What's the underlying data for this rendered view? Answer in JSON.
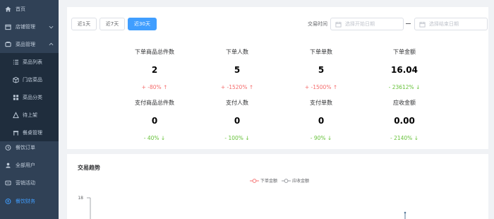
{
  "sidebar": {
    "items": [
      {
        "label": "首页",
        "icon": "home-icon"
      },
      {
        "label": "店铺管理",
        "icon": "shop-icon"
      },
      {
        "label": "菜品管理",
        "icon": "menu-icon"
      },
      {
        "label": "菜品列表",
        "icon": "list-icon"
      },
      {
        "label": "门店菜品",
        "icon": "box-icon"
      },
      {
        "label": "菜品分类",
        "icon": "grid-icon"
      },
      {
        "label": "待上架",
        "icon": "pending-icon"
      },
      {
        "label": "餐桌管理",
        "icon": "table-icon"
      },
      {
        "label": "餐饮订单",
        "icon": "order-icon"
      },
      {
        "label": "全部用户",
        "icon": "users-icon"
      },
      {
        "label": "营销活动",
        "icon": "marketing-icon"
      },
      {
        "label": "餐饮财务",
        "icon": "finance-icon"
      }
    ]
  },
  "filters": {
    "ranges": [
      "近1天",
      "近7天",
      "近30天"
    ],
    "active_range": "近30天",
    "trade_time_label": "交易时间",
    "start_placeholder": "选择开始日期",
    "end_placeholder": "选择结束日期"
  },
  "stats": [
    {
      "title": "下单商品总件数",
      "value": "2",
      "change": "+ -80%",
      "dir": "up"
    },
    {
      "title": "下单人数",
      "value": "5",
      "change": "+ -1520%",
      "dir": "up"
    },
    {
      "title": "下单单数",
      "value": "5",
      "change": "+ -1500%",
      "dir": "up"
    },
    {
      "title": "下单金额",
      "value": "16.04",
      "change": "- 23612%",
      "dir": "down"
    },
    {
      "title": "支付商品总件数",
      "value": "0",
      "change": "- 40%",
      "dir": "down"
    },
    {
      "title": "支付人数",
      "value": "0",
      "change": "- 100%",
      "dir": "down"
    },
    {
      "title": "支付单数",
      "value": "0",
      "change": "- 90%",
      "dir": "down"
    },
    {
      "title": "应收金额",
      "value": "0.00",
      "change": "- 2140%",
      "dir": "down"
    }
  ],
  "trend": {
    "title": "交易趋势",
    "legend": [
      "下单金额",
      "应收金额"
    ],
    "y_max_label": "18"
  },
  "colors": {
    "sidebar_bg": "#304156",
    "accent": "#409eff",
    "up": "#f56c6c",
    "down": "#67c23a",
    "series1": "#f56c6c",
    "series2": "#909399"
  }
}
